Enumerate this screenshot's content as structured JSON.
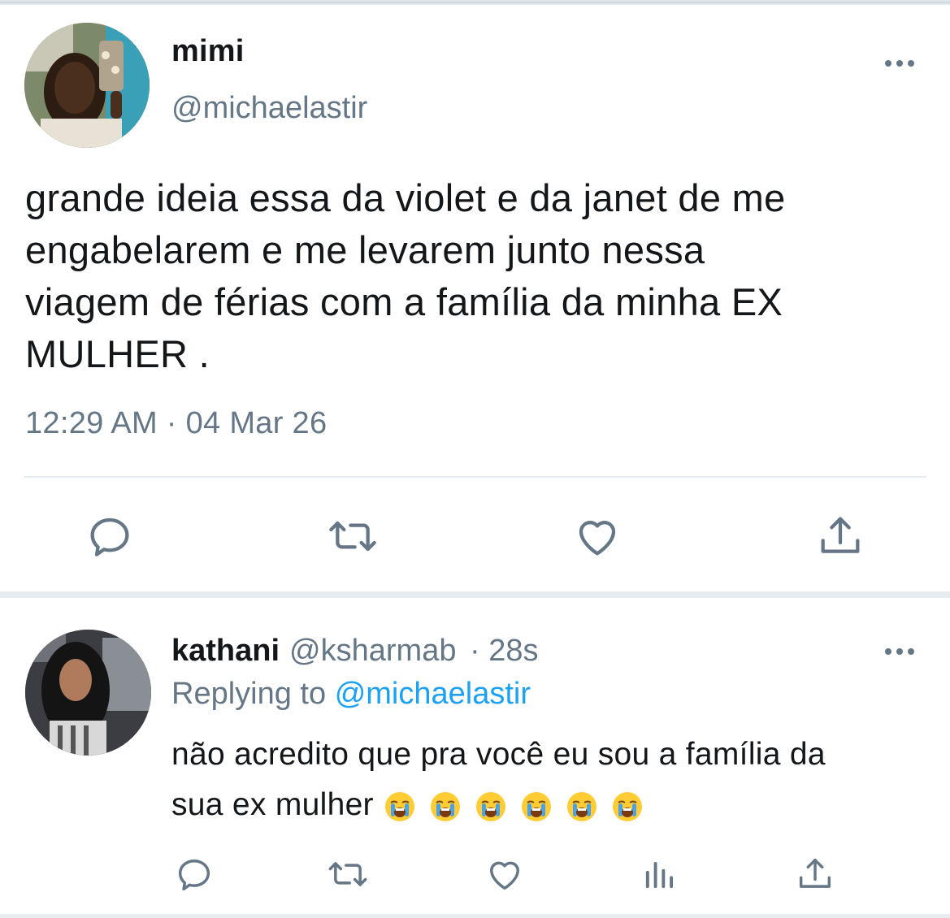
{
  "tweet": {
    "author_name": "mimi",
    "author_handle": "@michaelastir",
    "text": "grande ideia essa da violet e da janet de me\nengabelarem e me levarem junto nessa\nviagem de férias com a família da minha EX\nMULHER .",
    "timestamp": "12:29 AM · 04 Mar 26",
    "actions": [
      "reply-icon",
      "retweet-icon",
      "like-icon",
      "share-icon"
    ]
  },
  "reply": {
    "author_name": "kathani",
    "author_handle": "@ksharmab",
    "age": "· 28s",
    "replying_prefix": "Replying to",
    "replying_to": "@michaelastir",
    "text": "não acredito que pra você eu sou a família da\nsua ex mulher",
    "emoji_count": 6,
    "emoji_name": "loudly-crying-face",
    "actions": [
      "reply-icon",
      "retweet-icon",
      "like-icon",
      "analytics-icon",
      "share-icon"
    ]
  },
  "colors": {
    "secondary_text": "#657786",
    "link": "#1da1f2",
    "icon": "#657786",
    "divider": "#e6ecf0"
  }
}
